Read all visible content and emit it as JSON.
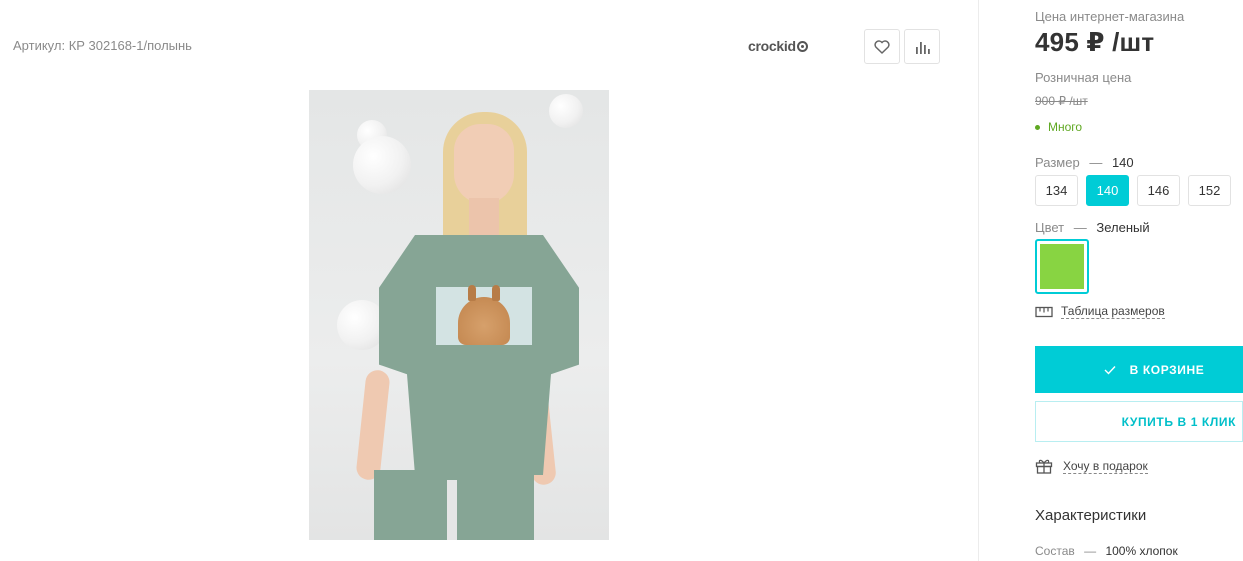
{
  "product": {
    "sku": "Артикул: КР 302168-1/полынь",
    "brand": "crockid"
  },
  "actions": {
    "favorite_icon": "heart-icon",
    "compare_icon": "bar-chart-icon"
  },
  "pricing": {
    "online_label": "Цена интернет-магазина",
    "online_price": "495 ₽ /шт",
    "retail_label": "Розничная цена",
    "retail_price": "900 ₽ /шт"
  },
  "stock": {
    "status": "Много",
    "color": "#5fa822"
  },
  "size": {
    "label": "Размер",
    "separator": "—",
    "selected": "140",
    "options": [
      "134",
      "140",
      "146",
      "152"
    ]
  },
  "color": {
    "label": "Цвет",
    "separator": "—",
    "selected": "Зеленый",
    "swatch_hex": "#88d442"
  },
  "size_table": {
    "label": "Таблица размеров",
    "icon": "ruler-icon"
  },
  "buttons": {
    "cart_label": "В КОРЗИНЕ",
    "cart_icon": "check-icon",
    "one_click_label": "КУПИТЬ В 1 КЛИК",
    "accent": "#00ccd6"
  },
  "gift": {
    "label": "Хочу в подарок",
    "icon": "gift-icon"
  },
  "characteristics": {
    "title": "Характеристики",
    "composition_label": "Состав",
    "separator": "—",
    "composition_value": "100% хлопок"
  }
}
